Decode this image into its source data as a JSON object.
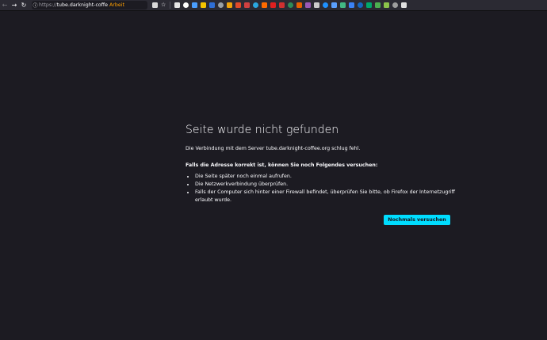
{
  "browser": {
    "url_scheme": "https://",
    "url_host": "tube.darknight-coffe",
    "container_label": "Arbeit",
    "back_icon": "arrow-left-icon",
    "forward_icon": "arrow-right-icon",
    "reload_icon": "reload-icon",
    "toolbar_bg": "#2b2a33",
    "extension_colors": [
      "#e6e6e6",
      "#ffffff",
      "#4a9eff",
      "#f5c400",
      "#2f6fd6",
      "#9aa0a6",
      "#f0a30a",
      "#e04b2a",
      "#d04040",
      "#2aa7e0",
      "#ff6a00",
      "#e02020",
      "#d03030",
      "#2e8b57",
      "#e66000",
      "#9b59b6",
      "#cccccc",
      "#1e90ff",
      "#5aa0ff",
      "#42b883",
      "#3b82f6",
      "#1565c0",
      "#00a86b",
      "#4caf50",
      "#8bc34a",
      "#9e9e9e",
      "#e0e0e0"
    ]
  },
  "error": {
    "title": "Seite wurde nicht gefunden",
    "description": "Die Verbindung mit dem Server tube.darknight-coffee.org schlug fehl.",
    "hint_heading": "Falls die Adresse korrekt ist, können Sie noch Folgendes versuchen:",
    "tips": [
      "Die Seite später noch einmal aufrufen.",
      "Die Netzwerkverbindung überprüfen.",
      "Falls der Computer sich hinter einer Firewall befindet, überprüfen Sie bitte, ob Firefox der Internetzugriff erlaubt wurde."
    ],
    "retry_label": "Nochmals versuchen",
    "accent": "#00ddff",
    "page_bg": "#1c1b22"
  }
}
